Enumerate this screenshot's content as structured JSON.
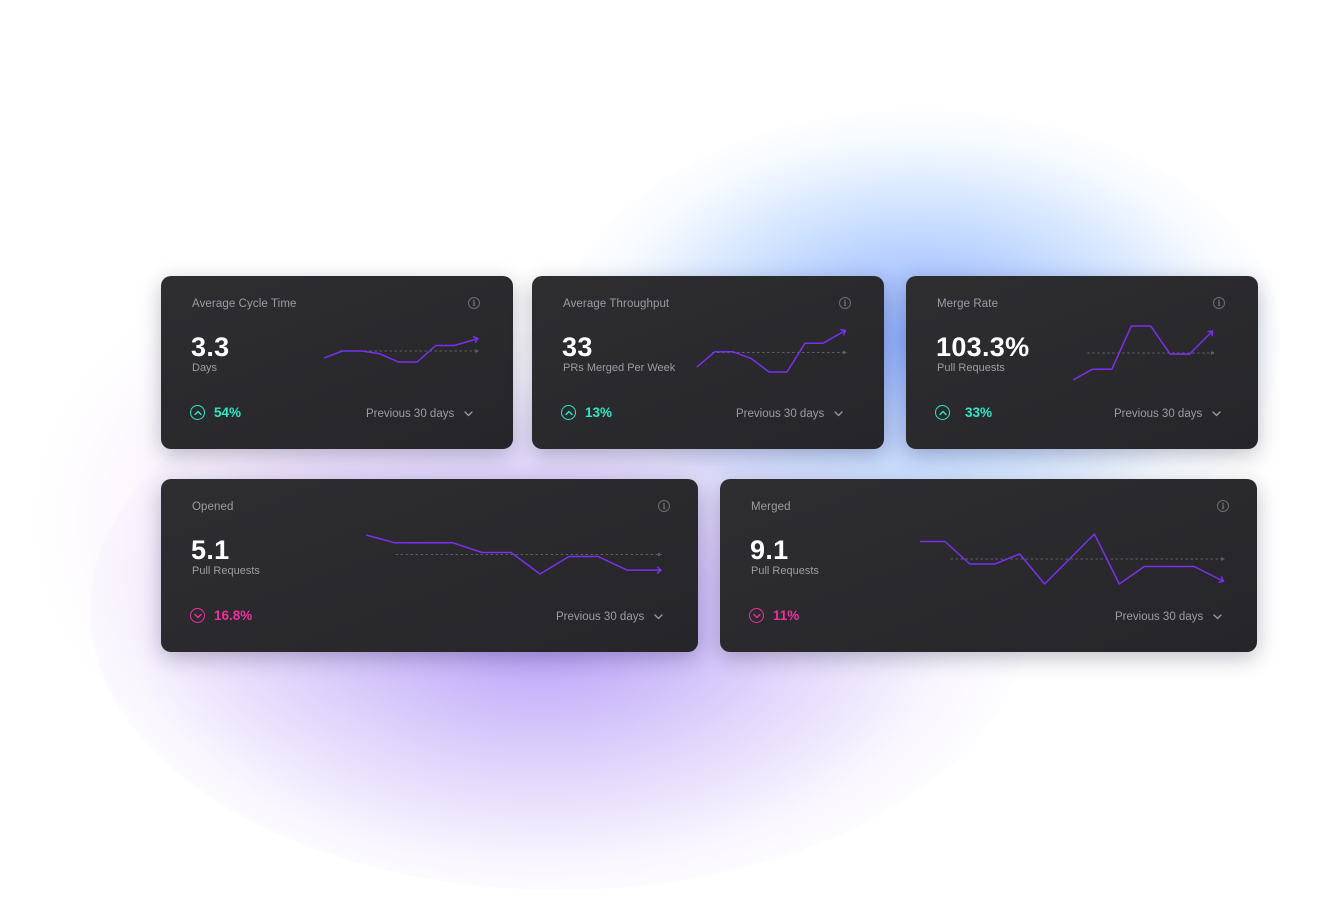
{
  "colors": {
    "up": "#2ee8c7",
    "down": "#ee2f9e",
    "line": "#7b2ff0",
    "baseline": "#5d5d66"
  },
  "cards": [
    {
      "title": "Average Cycle Time",
      "value": "3.3",
      "unit": "Days",
      "delta": "54%",
      "direction": "up",
      "period": "Previous 30 days",
      "sparkline": [
        3,
        8,
        8,
        6,
        0,
        0,
        12,
        12,
        16
      ]
    },
    {
      "title": "Average Throughput",
      "value": "33",
      "unit": "PRs Merged Per Week",
      "delta": "13%",
      "direction": "up",
      "period": "Previous 30 days",
      "sparkline": [
        3,
        12,
        12,
        8,
        0,
        0,
        17,
        17,
        23
      ]
    },
    {
      "title": "Merge Rate",
      "value": "103.3%",
      "unit": "Pull Requests",
      "delta": "33%",
      "direction": "up",
      "period": "Previous 30 days",
      "sparkline": [
        0,
        5,
        5,
        25,
        25,
        12,
        12,
        21
      ]
    },
    {
      "title": "Opened",
      "value": "5.1",
      "unit": "Pull Requests",
      "delta": "16.8%",
      "direction": "down",
      "period": "Previous 30 days",
      "sparkline": [
        20,
        16,
        16,
        16,
        11,
        11,
        0,
        9,
        9,
        2,
        2
      ]
    },
    {
      "title": "Merged",
      "value": "9.1",
      "unit": "Pull Requests",
      "delta": "11%",
      "direction": "down",
      "period": "Previous 30 days",
      "sparkline": [
        17,
        17,
        8,
        8,
        12,
        0,
        10,
        20,
        0,
        7,
        7,
        7,
        2
      ]
    }
  ]
}
